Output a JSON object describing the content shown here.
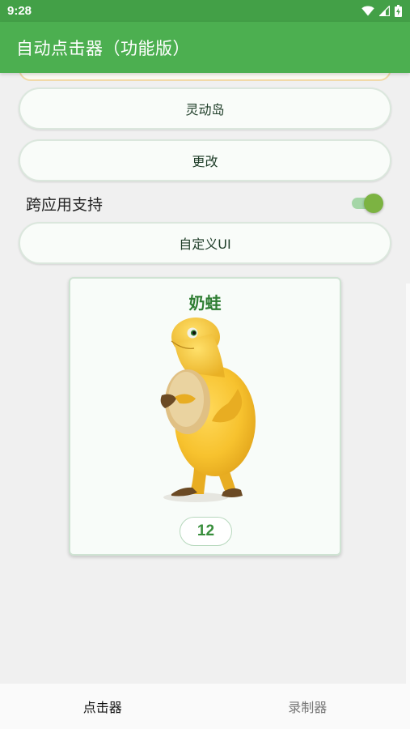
{
  "status_bar": {
    "time": "9:28",
    "icons": [
      "wifi-icon",
      "signal-icon",
      "battery-charging-icon"
    ]
  },
  "app_bar": {
    "title": "自动点击器（功能版）"
  },
  "buttons": {
    "dynamic_island": "灵动岛",
    "change": "更改",
    "custom_ui": "自定义UI"
  },
  "settings": {
    "cross_app_label": "跨应用支持",
    "cross_app_enabled": true
  },
  "card": {
    "title": "奶蛙",
    "figure": "yellow-frog-character",
    "count": "12"
  },
  "bottom_nav": {
    "items": [
      {
        "label": "点击器",
        "active": true
      },
      {
        "label": "录制器",
        "active": false
      }
    ]
  },
  "colors": {
    "primary": "#4caf50",
    "status_bar": "#43a047",
    "accent_text": "#2e7d32",
    "toggle_thumb": "#7cb342"
  }
}
